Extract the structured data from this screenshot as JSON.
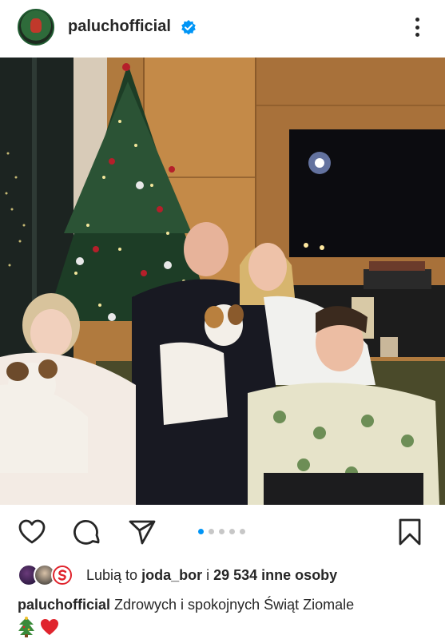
{
  "post": {
    "username": "paluchofficial",
    "verified": true,
    "avatar_icon": "profile-avatar"
  },
  "carousel": {
    "total": 5,
    "active_index": 0
  },
  "likes": {
    "prefix": "Lubią to",
    "user": "joda_bor",
    "connector": "i",
    "count_text": "29 534 inne osoby"
  },
  "caption": {
    "username": "paluchofficial",
    "text": "Zdrowych i spokojnych Świąt Ziomale",
    "emojis": "🎄❤️"
  },
  "colors": {
    "accent": "#0095f6",
    "text": "#262626",
    "verified": "#0095f6"
  },
  "icons": {
    "like": "heart-icon",
    "comment": "comment-icon",
    "share": "send-icon",
    "save": "bookmark-icon",
    "menu": "more-options-icon"
  }
}
